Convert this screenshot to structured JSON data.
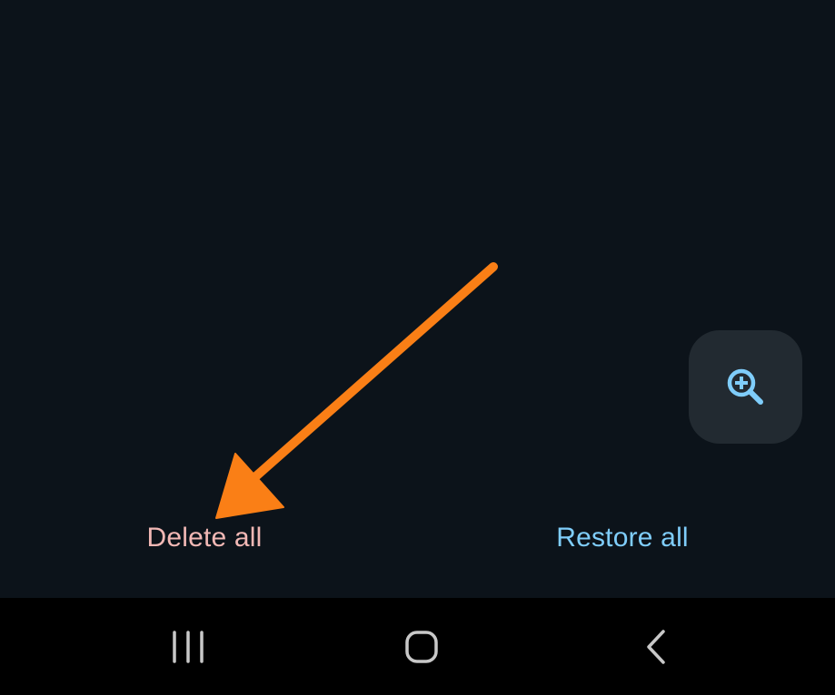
{
  "actions": {
    "delete_all_label": "Delete all",
    "restore_all_label": "Restore all"
  },
  "fab": {
    "icon": "zoom-in-icon"
  },
  "navigation": {
    "recents_icon": "recents-icon",
    "home_icon": "home-icon",
    "back_icon": "back-icon"
  },
  "colors": {
    "app_background": "#0c131a",
    "fab_background": "#222a31",
    "delete_text": "#f2b8b5",
    "restore_text": "#7fcdfa",
    "accent_icon": "#7fcdfa",
    "annotation_arrow": "#fa7f16",
    "nav_bar": "#000000",
    "nav_icon": "#c8c8c8"
  }
}
